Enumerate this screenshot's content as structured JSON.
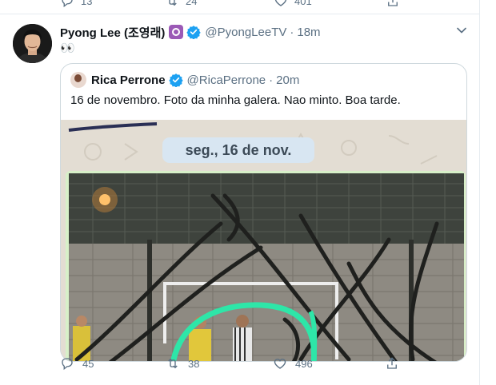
{
  "previous_tweet": {
    "reply_count": "13",
    "retweet_count": "24",
    "like_count": "401"
  },
  "tweet": {
    "display_name": "Pyong Lee (조영래)",
    "handle": "@PyongLeeTV",
    "separator": "·",
    "time": "18m",
    "text": "👀",
    "reply_count": "45",
    "retweet_count": "38",
    "like_count": "496"
  },
  "quoted_tweet": {
    "display_name": "Rica Perrone",
    "handle": "@RicaPerrone",
    "separator": "·",
    "time": "20m",
    "text": "16 de novembro. Foto da minha galera. Nao minto. Boa tarde.",
    "media": {
      "date_chip": "seg., 16 de nov."
    }
  },
  "icons": {
    "reply": "reply-icon",
    "retweet": "retweet-icon",
    "like": "heart-icon",
    "share": "share-icon",
    "more": "chevron-down-icon",
    "verified": "verified-badge-icon"
  },
  "colors": {
    "verified_blue": "#1da1f2",
    "secondary_text": "#5b7083",
    "border": "#cfd9de",
    "highlight_green": "#2ee6a8"
  }
}
